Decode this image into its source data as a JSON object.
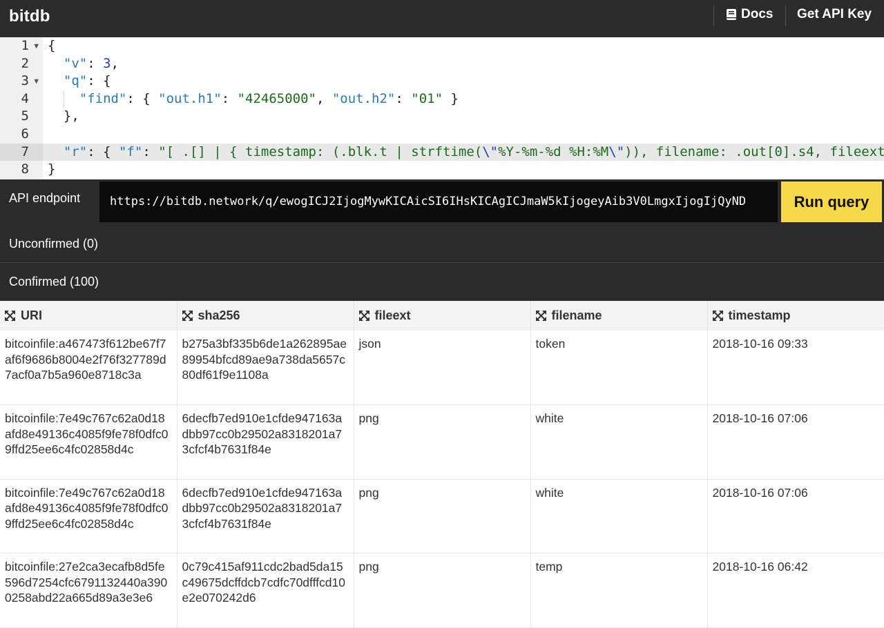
{
  "app": {
    "brand": "bitdb",
    "nav": {
      "docs_label": "Docs",
      "api_key_label": "Get API Key"
    }
  },
  "editor": {
    "active_line": 7,
    "lines": [
      {
        "num": "1",
        "fold": true
      },
      {
        "num": "2",
        "fold": false
      },
      {
        "num": "3",
        "fold": true
      },
      {
        "num": "4",
        "fold": false
      },
      {
        "num": "5",
        "fold": false
      },
      {
        "num": "6",
        "fold": false
      },
      {
        "num": "7",
        "fold": false
      },
      {
        "num": "8",
        "fold": false
      }
    ],
    "tokens": {
      "l1_open": "{",
      "l2_key": "\"v\"",
      "l2_colon": ": ",
      "l2_val": "3",
      "l2_comma": ",",
      "l3_key": "\"q\"",
      "l3_rest": ": {",
      "l4_key": "\"find\"",
      "l4_open": ": { ",
      "l4_k1": "\"out.h1\"",
      "l4_c1": ": ",
      "l4_v1": "\"42465000\"",
      "l4_sep": ", ",
      "l4_k2": "\"out.h2\"",
      "l4_c2": ": ",
      "l4_v2": "\"01\"",
      "l4_close": " }",
      "l5_close": "},",
      "l7_key": "\"r\"",
      "l7_mid1": ": { ",
      "l7_fkey": "\"f\"",
      "l7_mid2": ": ",
      "l7_s1": "\"[ .[] | { timestamp: (.blk.t | strftime(",
      "l7_e1": "\\\"",
      "l7_s2": "%Y-%m-%d %H:%M",
      "l7_e2": "\\\"",
      "l7_s3": ")), filename: .out[0].s4, fileext",
      "l8_close": "}"
    }
  },
  "api": {
    "label": "API endpoint",
    "url": "https://bitdb.network/q/ewogICJ2IjogMywKICAicSI6IHsKICAgICJmaW5kIjogeyAib3V0LmgxIjogIjQyND",
    "run_label": "Run query"
  },
  "sections": {
    "unconfirmed": "Unconfirmed (0)",
    "confirmed": "Confirmed (100)"
  },
  "table": {
    "columns": [
      "URI",
      "sha256",
      "fileext",
      "filename",
      "timestamp"
    ],
    "rows": [
      {
        "uri": "bitcoinfile:a467473f612be67f7af6f9686b8004e2f76f327789d7acf0a7b5a960e8718c3a",
        "sha256": "b275a3bf335b6de1a262895ae89954bfcd89ae9a738da5657c80df61f9e1108a",
        "fileext": "json",
        "filename": "token",
        "timestamp": "2018-10-16 09:33"
      },
      {
        "uri": "bitcoinfile:7e49c767c62a0d18afd8e49136c4085f9fe78f0dfc09ffd25ee6c4fc02858d4c",
        "sha256": "6decfb7ed910e1cfde947163adbb97cc0b29502a8318201a73cfcf4b7631f84e",
        "fileext": "png",
        "filename": "white",
        "timestamp": "2018-10-16 07:06"
      },
      {
        "uri": "bitcoinfile:7e49c767c62a0d18afd8e49136c4085f9fe78f0dfc09ffd25ee6c4fc02858d4c",
        "sha256": "6decfb7ed910e1cfde947163adbb97cc0b29502a8318201a73cfcf4b7631f84e",
        "fileext": "png",
        "filename": "white",
        "timestamp": "2018-10-16 07:06"
      },
      {
        "uri": "bitcoinfile:27e2ca3ecafb8d5fe596d7254cfc6791132440a3900258abd22a665d89a3e3e6",
        "sha256": "0c79c415af911cdc2bad5da15c49675dcffdcb7cdfc70dfffcd10e2e070242d6",
        "fileext": "png",
        "filename": "temp",
        "timestamp": "2018-10-16 06:42"
      }
    ]
  },
  "icons": {
    "docs": "book-icon",
    "column": "expand-arrows-icon"
  },
  "colors": {
    "topbar": "#2b2b2b",
    "run_button": "#f6d84a",
    "string_token": "#1a6b1a",
    "key_token": "#2a7ab0"
  }
}
